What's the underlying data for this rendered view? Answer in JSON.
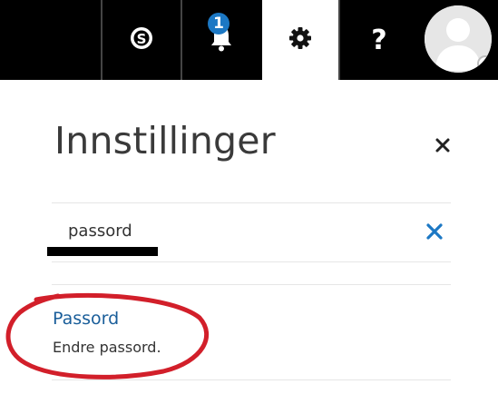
{
  "topbar": {
    "notification_count": "1",
    "help_label": "?"
  },
  "panel": {
    "title": "Innstillinger"
  },
  "search": {
    "value": "passord"
  },
  "results": [
    {
      "title": "Passord",
      "description": "Endre passord."
    }
  ],
  "colors": {
    "topbar_bg": "#000000",
    "badge": "#1c78c4",
    "link": "#1a5e9a",
    "annotation": "#d21f2a"
  },
  "icons": {
    "skype": "skype-icon",
    "bell": "bell-icon",
    "gear": "gear-icon",
    "help": "help-icon",
    "close": "close-icon",
    "clear": "clear-search-icon"
  }
}
